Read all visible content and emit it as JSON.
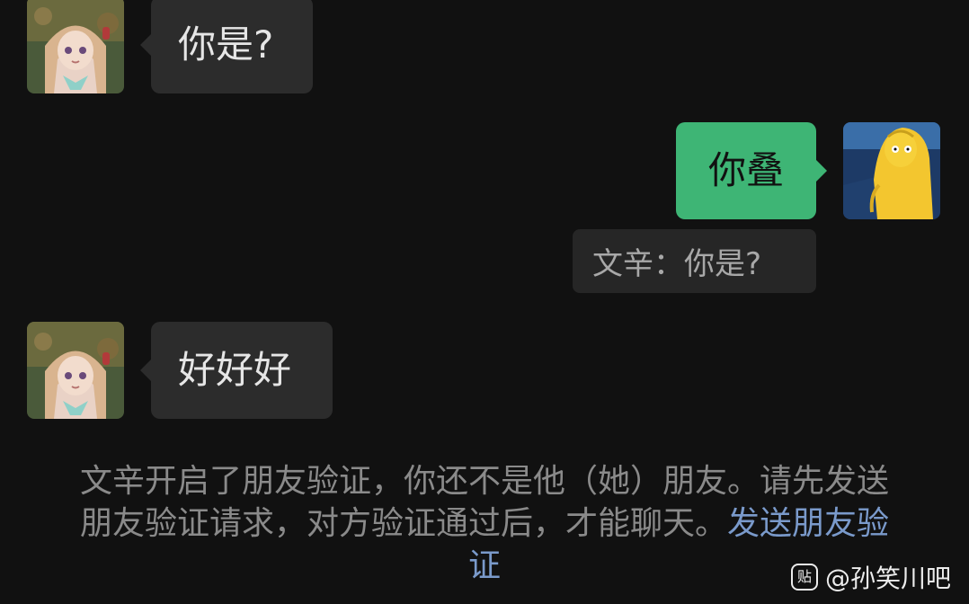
{
  "messages": [
    {
      "sender": "contact",
      "text": "你是?",
      "avatar": "anime-girl-avatar"
    },
    {
      "sender": "me",
      "text": "你叠",
      "avatar": "yellow-cartoon-avatar",
      "quote": "文辛：你是?"
    },
    {
      "sender": "contact",
      "text": "好好好",
      "avatar": "anime-girl-avatar"
    }
  ],
  "system_notice": {
    "text": "文辛开启了朋友验证，你还不是他（她）朋友。请先发送朋友验证请求，对方验证通过后，才能聊天。",
    "link": "发送朋友验证"
  },
  "watermark": {
    "logo": "贴",
    "text": "@孙笑川吧"
  },
  "colors": {
    "background": "#111111",
    "incoming_bubble": "#2c2c2c",
    "outgoing_bubble": "#3eb575",
    "quote_bubble": "#262626",
    "notice_text": "#8a8a8a",
    "link": "#7a9acb"
  }
}
